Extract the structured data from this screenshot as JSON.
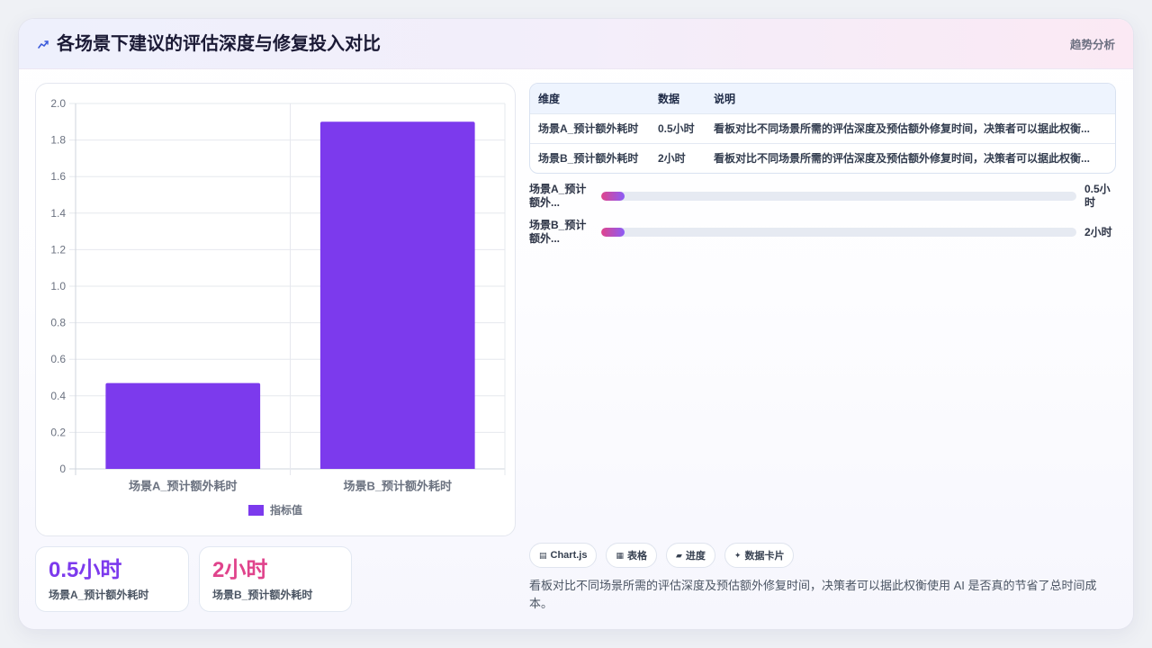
{
  "theme": {
    "accent": "#7c3aed",
    "pink": "#e0448c",
    "icon_blue": "#3b5bdb"
  },
  "header": {
    "title": "各场景下建议的评估深度与修复投入对比",
    "icon": "trend-icon",
    "right_label": "趋势分析"
  },
  "chart_data": {
    "type": "bar",
    "categories": [
      "场景A_预计额外耗时",
      "场景B_预计额外耗时"
    ],
    "series": [
      {
        "name": "指标值",
        "values": [
          0.47,
          1.9
        ],
        "color": "#7c3aed"
      }
    ],
    "ylim": [
      0,
      2.0
    ],
    "yticks": [
      0,
      0.2,
      0.4,
      0.6,
      0.8,
      1.0,
      1.2,
      1.4,
      1.6,
      1.8,
      2.0
    ],
    "ytick_labels": [
      "0",
      "0.2",
      "0.4",
      "0.6",
      "0.8",
      "1.0",
      "1.2",
      "1.4",
      "1.6",
      "1.8",
      "2.0"
    ],
    "grid": true,
    "legend": "bottom"
  },
  "kpis": [
    {
      "value": "0.5小时",
      "label": "场景A_预计额外耗时",
      "color": "#7c3aed"
    },
    {
      "value": "2小时",
      "label": "场景B_预计额外耗时",
      "color": "#e0448c"
    }
  ],
  "table": {
    "headers": [
      "维度",
      "数据",
      "说明"
    ],
    "rows": [
      [
        "场景A_预计额外耗时",
        "0.5小时",
        "看板对比不同场景所需的评估深度及预估额外修复时间，决策者可以据此权衡..."
      ],
      [
        "场景B_预计额外耗时",
        "2小时",
        "看板对比不同场景所需的评估深度及预估额外修复时间，决策者可以据此权衡..."
      ]
    ]
  },
  "progress": [
    {
      "label": "场景A_预计额外...",
      "value": "0.5小时",
      "fill_percent": 5
    },
    {
      "label": "场景B_预计额外...",
      "value": "2小时",
      "fill_percent": 5
    }
  ],
  "tags": [
    {
      "icon": "chart-icon",
      "glyph": "▤",
      "label": "Chart.js"
    },
    {
      "icon": "table-icon",
      "glyph": "▦",
      "label": "表格"
    },
    {
      "icon": "progress-icon",
      "glyph": "▰",
      "label": "进度"
    },
    {
      "icon": "sparkle-icon",
      "glyph": "✦",
      "label": "数据卡片"
    }
  ],
  "description": "看板对比不同场景所需的评估深度及预估额外修复时间，决策者可以据此权衡使用 AI 是否真的节省了总时间成本。"
}
